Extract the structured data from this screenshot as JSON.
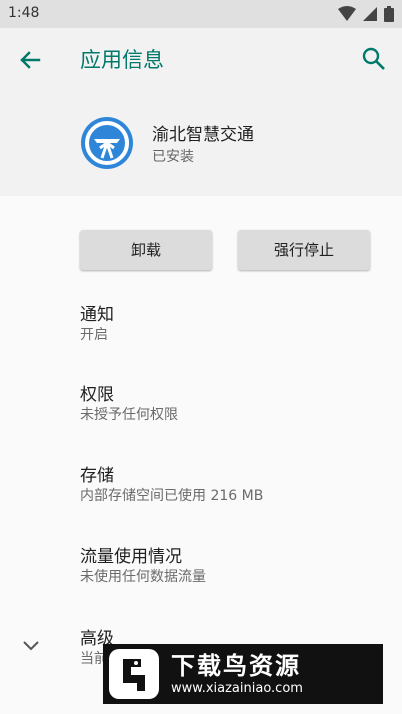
{
  "status_bar": {
    "time": "1:48"
  },
  "app_bar": {
    "title": "应用信息"
  },
  "app": {
    "name": "渝北智慧交通",
    "status": "已安装"
  },
  "actions": {
    "uninstall": "卸载",
    "force_stop": "强行停止"
  },
  "settings": [
    {
      "title": "通知",
      "subtitle": "开启"
    },
    {
      "title": "权限",
      "subtitle": "未授予任何权限"
    },
    {
      "title": "存储",
      "subtitle": "内部存储空间已使用 216 MB"
    },
    {
      "title": "流量使用情况",
      "subtitle": "未使用任何数据流量"
    },
    {
      "title": "高级",
      "subtitle": "当前"
    }
  ],
  "watermark": {
    "title": "下载鸟资源",
    "url": "www.xiazainiao.com"
  },
  "colors": {
    "accent": "#00796b",
    "app_icon_blue": "#2f86d9"
  },
  "icons": [
    "wifi-icon",
    "cellular-icon",
    "battery-icon",
    "back-arrow-icon",
    "search-icon",
    "chevron-down-icon"
  ]
}
